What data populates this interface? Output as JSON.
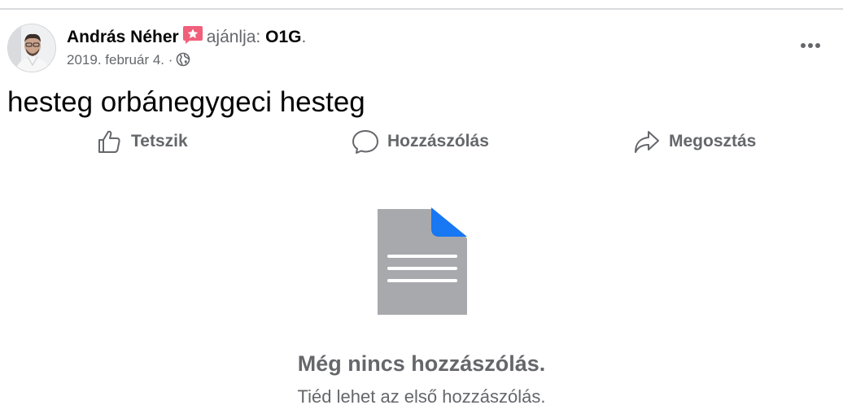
{
  "post": {
    "author": "András Néher",
    "recommends_text": "ajánlja:",
    "page_name": "O1G",
    "page_suffix": ".",
    "date": "2019. február 4.",
    "meta_separator": "·",
    "audience_icon": "globe-icon",
    "badge_icon": "recommendation-star-icon",
    "text": "hesteg orbánegygeci hesteg"
  },
  "actions": {
    "like_label": "Tetszik",
    "comment_label": "Hozzászólás",
    "share_label": "Megosztás"
  },
  "empty_state": {
    "icon": "document-icon",
    "title": "Még nincs hozzászólás.",
    "subtitle": "Tiéd lehet az első hozzászólás."
  },
  "colors": {
    "text_primary": "#050505",
    "text_secondary": "#65676b",
    "badge": "#f0607b",
    "doc_gray": "#a8a9ad",
    "doc_accent": "#1877f2"
  }
}
